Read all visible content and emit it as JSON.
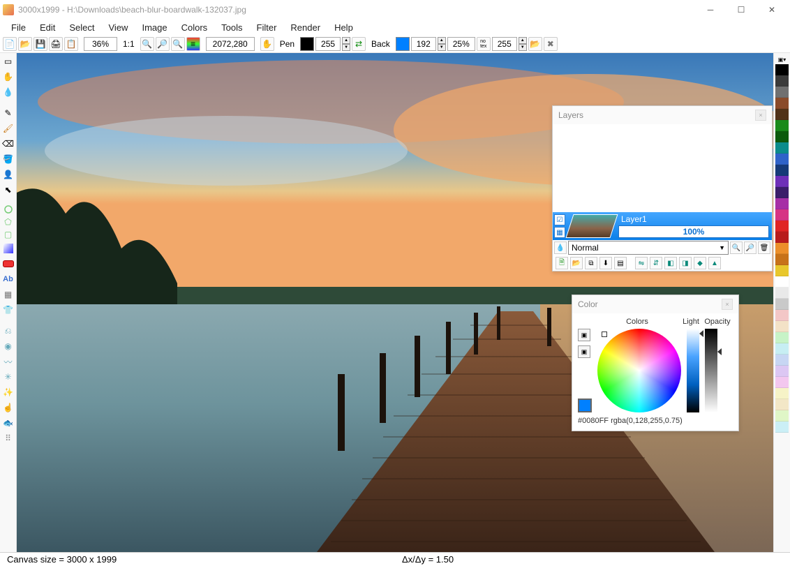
{
  "title": "3000x1999 - H:\\Downloads\\beach-blur-boardwalk-132037.jpg",
  "menu": [
    "File",
    "Edit",
    "Select",
    "View",
    "Image",
    "Colors",
    "Tools",
    "Filter",
    "Render",
    "Help"
  ],
  "toolbar": {
    "zoom": "36%",
    "ratio": "1:1",
    "coords": "2072,280",
    "pen_label": "Pen",
    "pen_alpha": "255",
    "back_label": "Back",
    "back_alpha": "192",
    "alpha_pct": "25%",
    "tex_alpha": "255",
    "pen_color": "#000000",
    "back_color": "#0080FF"
  },
  "layers": {
    "title": "Layers",
    "items": [
      {
        "name": "Layer1",
        "opacity": "100%"
      }
    ],
    "blend": "Normal"
  },
  "color_panel": {
    "title": "Color",
    "labels": {
      "colors": "Colors",
      "light": "Light",
      "opacity": "Opacity"
    },
    "current": "#0080FF",
    "readout": "#0080FF  rgba(0,128,255,0.75)"
  },
  "swatches": [
    "#000000",
    "#3b3b3b",
    "#707070",
    "#8a4b2a",
    "#503218",
    "#1a8a1a",
    "#0c5a0c",
    "#0b8c8c",
    "#2f63c9",
    "#163a78",
    "#6e2fb8",
    "#3a1d6a",
    "#a62fa6",
    "#d63384",
    "#e02424",
    "#b81c1c",
    "#ec8f2a",
    "#c77219",
    "#e8c72c",
    "#ffffff",
    "#e9e9e9",
    "#c9c9c9",
    "#f3c7c7",
    "#f3e2c7",
    "#c7f3c7",
    "#c7eef3",
    "#c7d6f3",
    "#dcc7f3",
    "#f3c7ef",
    "#f6f3c7",
    "#f3e7c7",
    "#e0f6c7",
    "#cbeff6"
  ],
  "status": {
    "canvas": "Canvas size = 3000 x 1999",
    "delta": "Δx/Δy = 1.50"
  }
}
